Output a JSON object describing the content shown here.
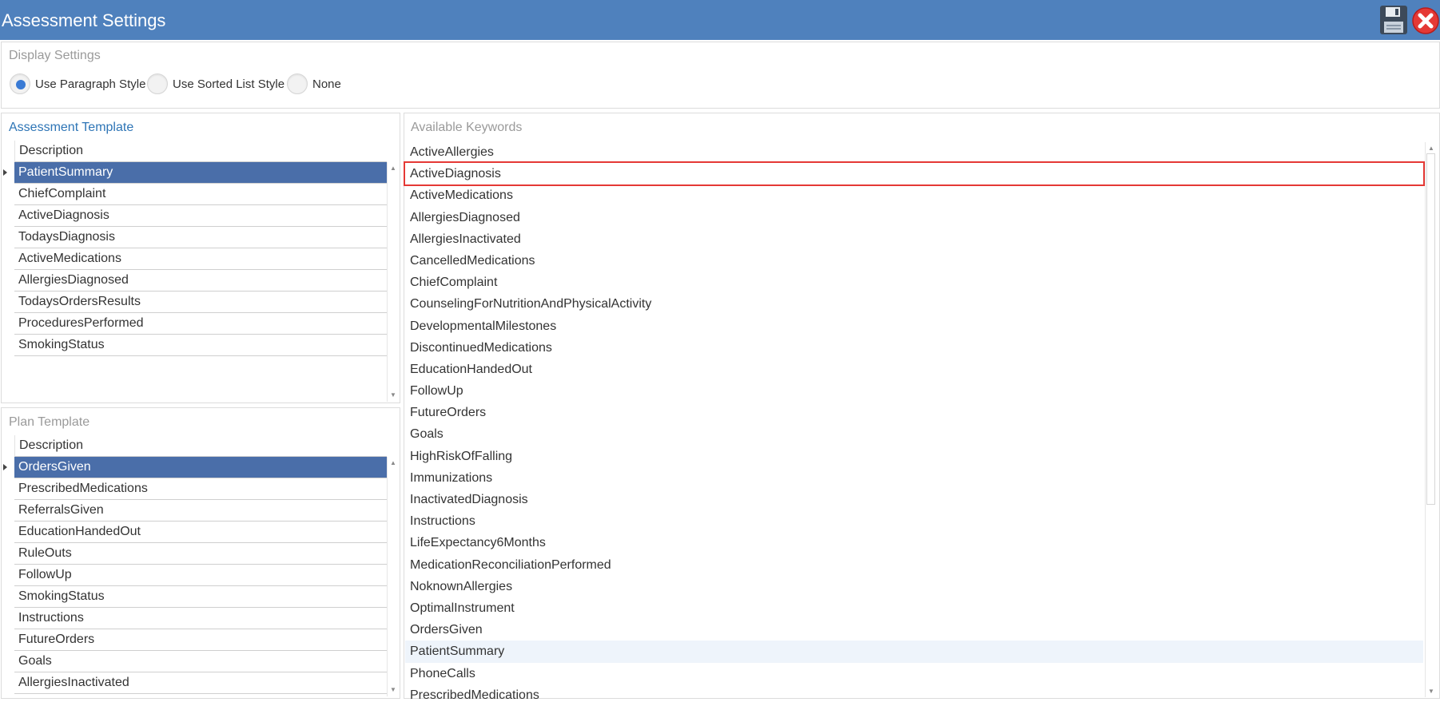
{
  "window": {
    "title": "Assessment Settings"
  },
  "toolbar": {
    "save_icon": "floppy-disk-icon",
    "close_icon": "close-icon",
    "close_color": "#e53935"
  },
  "display_settings": {
    "title": "Display Settings",
    "options": [
      {
        "label": "Use Paragraph Style",
        "checked": true
      },
      {
        "label": "Use Sorted List Style",
        "checked": false
      },
      {
        "label": "None",
        "checked": false
      }
    ]
  },
  "assessment_template": {
    "title": "Assessment Template",
    "column": "Description",
    "rows": [
      "PatientSummary",
      "ChiefComplaint",
      "ActiveDiagnosis",
      "TodaysDiagnosis",
      "ActiveMedications",
      "AllergiesDiagnosed",
      "TodaysOrdersResults",
      "ProceduresPerformed",
      "SmokingStatus"
    ],
    "selected": "PatientSummary"
  },
  "plan_template": {
    "title": "Plan Template",
    "column": "Description",
    "rows": [
      "OrdersGiven",
      "PrescribedMedications",
      "ReferralsGiven",
      "EducationHandedOut",
      "RuleOuts",
      "FollowUp",
      "SmokingStatus",
      "Instructions",
      "FutureOrders",
      "Goals",
      "AllergiesInactivated"
    ],
    "selected": "OrdersGiven"
  },
  "keywords": {
    "title": "Available Keywords",
    "items": [
      "ActiveAllergies",
      "ActiveDiagnosis",
      "ActiveMedications",
      "AllergiesDiagnosed",
      "AllergiesInactivated",
      "CancelledMedications",
      "ChiefComplaint",
      "CounselingForNutritionAndPhysicalActivity",
      "DevelopmentalMilestones",
      "DiscontinuedMedications",
      "EducationHandedOut",
      "FollowUp",
      "FutureOrders",
      "Goals",
      "HighRiskOfFalling",
      "Immunizations",
      "InactivatedDiagnosis",
      "Instructions",
      "LifeExpectancy6Months",
      "MedicationReconciliationPerformed",
      "NoknownAllergies",
      "OptimalInstrument",
      "OrdersGiven",
      "PatientSummary",
      "PhoneCalls",
      "PrescribedMedications"
    ],
    "highlighted": "ActiveDiagnosis",
    "hovered": "PatientSummary"
  },
  "colors": {
    "titlebar": "#4f81bd",
    "selected_row": "#4a6ea9",
    "highlight_outline": "#e53935",
    "radio_checked": "#3a7bd5"
  }
}
